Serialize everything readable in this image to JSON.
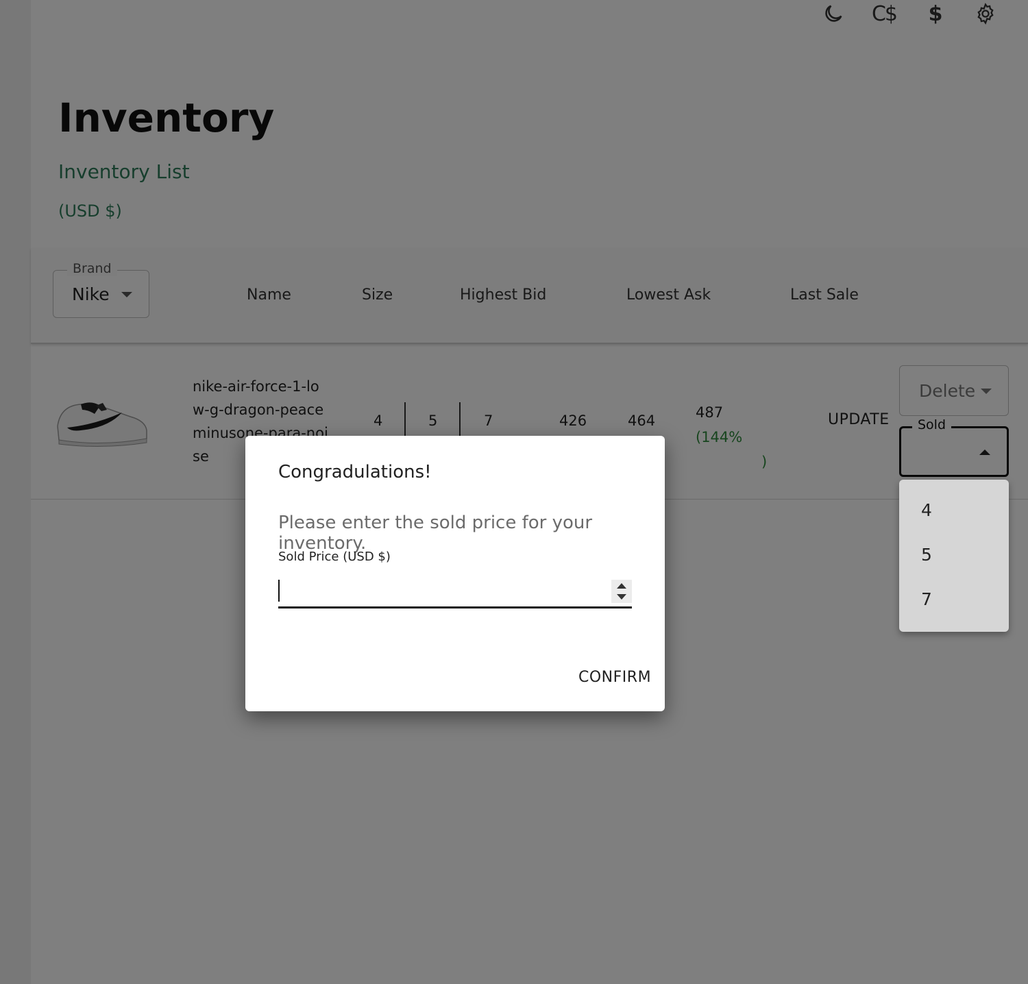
{
  "toolbar": {
    "icons": [
      "moon-icon",
      "cad-currency-icon",
      "usd-currency-icon",
      "gear-icon"
    ],
    "cad_label": "C$",
    "usd_label": "$"
  },
  "page": {
    "title": "Inventory",
    "subtitle": "Inventory List",
    "currency": "(USD $)"
  },
  "filters": {
    "brand_label": "Brand",
    "brand_value": "Nike"
  },
  "columns": [
    "Name",
    "Size",
    "Highest Bid",
    "Lowest Ask",
    "Last Sale"
  ],
  "rows": [
    {
      "name": "nike-air-force-1-low-g-dragon-peaceminusone-para-noise",
      "sizes": [
        "4",
        "5",
        "7"
      ],
      "highest_bid": "426",
      "lowest_ask": "464",
      "last_sale": "487",
      "last_sale_pct": "(144%",
      "last_sale_pct_close": ")",
      "update_label": "UPDATE",
      "delete_label": "Delete",
      "sold_label": "Sold"
    }
  ],
  "sold_menu": {
    "options": [
      "4",
      "5",
      "7"
    ]
  },
  "modal": {
    "title": "Congradulations!",
    "text": "Please enter the sold price for your inventory.",
    "field_label": "Sold Price (USD $)",
    "input_value": "",
    "confirm_label": "CONFIRM"
  },
  "colors": {
    "accent_green": "#2e7d5b",
    "positive_pct": "#2e8b3c"
  }
}
